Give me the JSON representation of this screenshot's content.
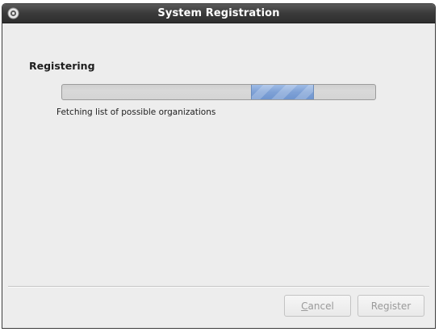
{
  "window": {
    "title": "System Registration"
  },
  "main": {
    "heading": "Registering",
    "status": "Fetching list of possible organizations"
  },
  "buttons": {
    "cancel": {
      "mnemonic": "C",
      "rest": "ancel",
      "enabled": false
    },
    "register": {
      "label": "Register",
      "enabled": false
    }
  },
  "icons": {
    "window_menu": "window-menu-icon"
  },
  "colors": {
    "titlebar": "#3a3a3a",
    "title_text": "#ffffff",
    "background": "#ededed",
    "progress_pulse": "#7ea1d6",
    "disabled_text": "#9a9a9a"
  }
}
